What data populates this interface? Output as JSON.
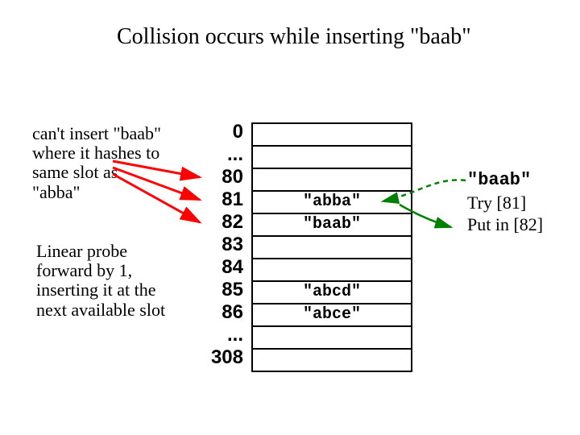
{
  "title": "Collision occurs while inserting \"baab\"",
  "left_note_1": "can't insert \"baab\" where it hashes to same slot as \"abba\"",
  "left_note_2": "Linear probe forward by 1, inserting it at the next available slot",
  "indices": {
    "r0": "0",
    "r1": "...",
    "r2": "80",
    "r3": "81",
    "r4": "82",
    "r5": "83",
    "r6": "84",
    "r7": "85",
    "r8": "86",
    "r9": "...",
    "r10": "308"
  },
  "table": {
    "c0": "",
    "c1": "",
    "c2": "",
    "c3": "\"abba\"",
    "c4": "\"baab\"",
    "c5": "",
    "c6": "",
    "c7": "\"abcd\"",
    "c8": "\"abce\"",
    "c9": "",
    "c10": ""
  },
  "right": {
    "item": "\"baab\"",
    "try": "Try [81]",
    "put": "Put in [82]"
  },
  "colors": {
    "arrow_red": "#ff0000",
    "arrow_green": "#008000"
  }
}
